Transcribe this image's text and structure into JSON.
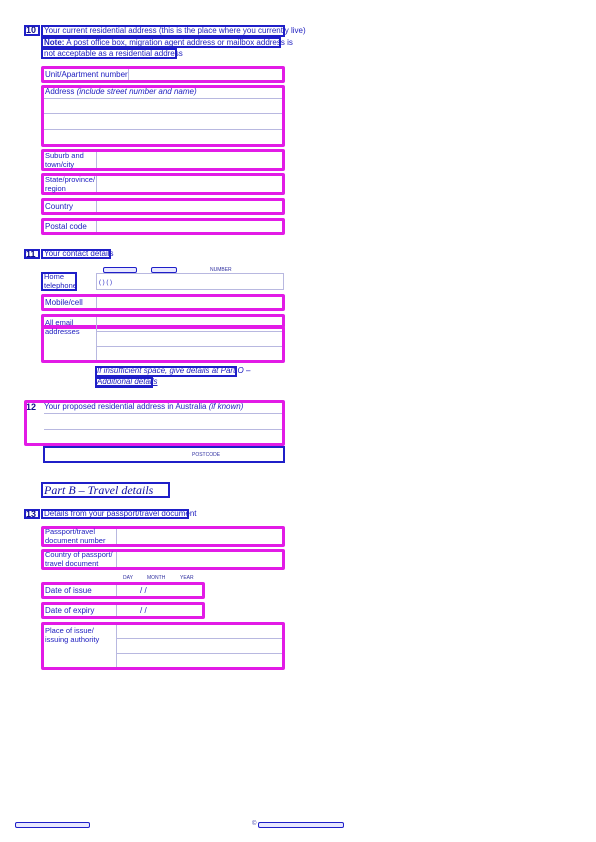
{
  "q10": {
    "number": "10",
    "line1": "Your current residential address (this is the place where you currently live)",
    "note_label": "Note:",
    "note_text": " A post office box, migration agent address or mailbox address is",
    "note_line2": "not acceptable as a residential address",
    "unit_label": "Unit/Apartment number",
    "address_label": "Address",
    "address_hint": "(include street number and name)",
    "suburb_label": "Suburb and town/city",
    "state_label": "State/province/ region",
    "country_label": "Country",
    "postal_label": "Postal code"
  },
  "q11": {
    "number": "11",
    "title": "Your contact details",
    "number_header": "NUMBER",
    "home_label": "Home telephone",
    "home_value": "(            )  (            )",
    "mobile_label": "Mobile/cell",
    "email_label": "All email addresses",
    "insufficient_line1": "If insufficient space, give details at Part O –",
    "insufficient_line2": "Additional details"
  },
  "q12": {
    "number": "12",
    "title": "Your proposed residential address in Australia",
    "title_hint": "(if known)",
    "postcode_label": "POSTCODE"
  },
  "partB": {
    "title": "Part B – Travel details"
  },
  "q13": {
    "number": "13",
    "title": "Details from your passport/travel document",
    "passport_label": "Passport/travel document number",
    "country_label": "Country of passport/ travel document",
    "day_label": "DAY",
    "month_label": "MONTH",
    "year_label": "YEAR",
    "issue_label": "Date of issue",
    "expiry_label": "Date of expiry",
    "date_sep": "/          /",
    "place_label": "Place of issue/ issuing authority"
  },
  "colors": {
    "accent": "#1f1fc8",
    "highlight": "#e21be6"
  }
}
